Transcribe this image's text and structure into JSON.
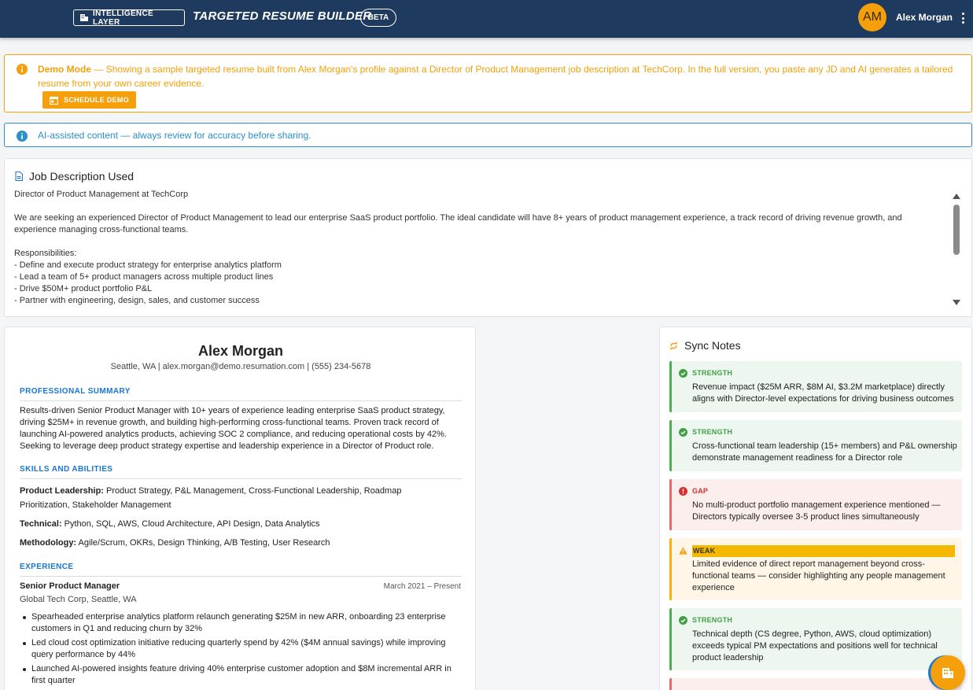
{
  "header": {
    "brand_label": "INTELLIGENCE LAYER",
    "app_title": "TARGETED RESUME BUILDER",
    "beta_label": "BETA",
    "avatar_initials": "AM",
    "user_name": "Alex Morgan",
    "bg_color": "#1f3a5f"
  },
  "demo_banner": {
    "title": "Demo Mode",
    "message": " — Showing a sample targeted resume built from Alex Morgan's profile against a Director of Product Management job description at TechCorp. In the full version, you paste any JD and AI generates a tailored resume from your own career evidence.",
    "button_label": "SCHEDULE DEMO",
    "color": "#f0a00c"
  },
  "ai_banner": {
    "message": "AI-assisted content — always review for accuracy before sharing.",
    "color": "#2b8fc9"
  },
  "job_description": {
    "title": "Job Description Used",
    "heading_line": "Director of Product Management at TechCorp",
    "intro": "We are seeking an experienced Director of Product Management to lead our enterprise SaaS product portfolio. The ideal candidate will have 8+ years of product management experience, a track record of driving revenue growth, and experience managing cross-functional teams.",
    "responsibilities_label": "Responsibilities:",
    "responsibilities": [
      "- Define and execute product strategy for enterprise analytics platform",
      "- Lead a team of 5+ product managers across multiple product lines",
      "- Drive $50M+ product portfolio P&L",
      "- Partner with engineering, design, sales, and customer success"
    ]
  },
  "resume": {
    "name": "Alex Morgan",
    "contact": "Seattle, WA | alex.morgan@demo.resumation.com | (555) 234-5678",
    "summary_heading": "PROFESSIONAL SUMMARY",
    "summary": "Results-driven Senior Product Manager with 10+ years of experience leading enterprise SaaS product strategy, driving $25M+ in revenue growth, and building high-performing cross-functional teams. Proven track record of launching AI-powered analytics products, achieving SOC 2 compliance, and reducing operational costs by 42%. Seeking to leverage deep product strategy expertise and leadership experience in a Director of Product role.",
    "skills_heading": "SKILLS AND ABILITIES",
    "skills": [
      {
        "label": "Product Leadership:",
        "value": " Product Strategy, P&L Management, Cross-Functional Leadership, Roadmap Prioritization, Stakeholder Management"
      },
      {
        "label": "Technical:",
        "value": " Python, SQL, AWS, Cloud Architecture, API Design, Data Analytics"
      },
      {
        "label": "Methodology:",
        "value": " Agile/Scrum, OKRs, Design Thinking, A/B Testing, User Research"
      }
    ],
    "experience_heading": "EXPERIENCE",
    "job": {
      "title": "Senior Product Manager",
      "dates": "March 2021 – Present",
      "company": "Global Tech Corp, Seattle, WA",
      "bullets": [
        "Spearheaded enterprise analytics platform relaunch generating $25M in new ARR, onboarding 23 enterprise customers in Q1 and reducing churn by 32%",
        "Led cloud cost optimization initiative reducing quarterly spend by 42% ($4M annual savings) while improving query performance by 44%",
        "Launched AI-powered insights feature driving 40% enterprise customer adoption and $8M incremental ARR in first quarter"
      ]
    }
  },
  "sync_notes": {
    "title": "Sync Notes",
    "notes": [
      {
        "type": "STRENGTH",
        "text": "Revenue impact ($25M ARR, $8M AI, $3.2M marketplace) directly aligns with Director-level expectations for driving business outcomes"
      },
      {
        "type": "STRENGTH",
        "text": "Cross-functional team leadership (15+ members) and P&L ownership demonstrate management readiness for a Director role"
      },
      {
        "type": "GAP",
        "text": "No multi-product portfolio management experience mentioned — Directors typically oversee 3-5 product lines simultaneously"
      },
      {
        "type": "WEAK",
        "text": "Limited evidence of direct report management beyond cross-functional teams — consider highlighting any people management experience"
      },
      {
        "type": "STRENGTH",
        "text": "Technical depth (CS degree, Python, AWS, cloud optimization) exceeds typical PM expectations and positions well for technical product leadership"
      }
    ],
    "colors": {
      "strength": "#4caf50",
      "gap": "#e26a6a",
      "weak": "#f5b30a"
    }
  }
}
